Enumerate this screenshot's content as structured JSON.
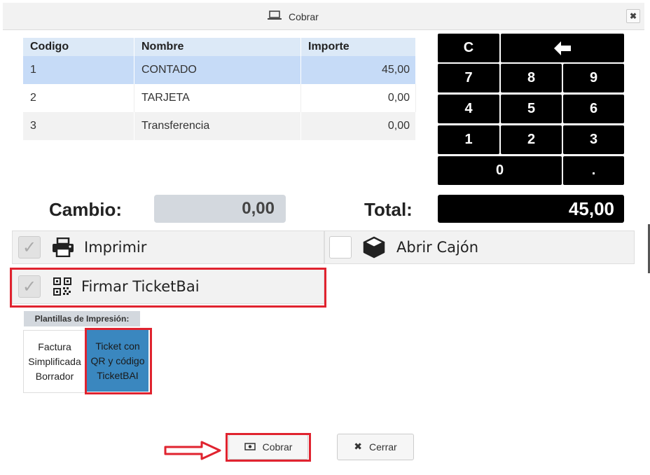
{
  "dialog": {
    "title": "Cobrar",
    "close_glyph": "✖"
  },
  "table": {
    "headers": [
      "Codigo",
      "Nombre",
      "Importe"
    ],
    "rows": [
      {
        "codigo": "1",
        "nombre": "CONTADO",
        "importe": "45,00"
      },
      {
        "codigo": "2",
        "nombre": "TARJETA",
        "importe": "0,00"
      },
      {
        "codigo": "3",
        "nombre": "Transferencia",
        "importe": "0,00"
      }
    ]
  },
  "keypad": {
    "clear": "C",
    "backspace": "🡸",
    "k7": "7",
    "k8": "8",
    "k9": "9",
    "k4": "4",
    "k5": "5",
    "k6": "6",
    "k1": "1",
    "k2": "2",
    "k3": "3",
    "k0": "0",
    "dot": "."
  },
  "totals": {
    "cambio_label": "Cambio:",
    "cambio_value": "0,00",
    "total_label": "Total:",
    "total_value": "45,00"
  },
  "options": {
    "imprimir": {
      "label": "Imprimir",
      "checked": true,
      "icon": "printer-icon"
    },
    "abrir_cajon": {
      "label": "Abrir Cajón",
      "checked": false,
      "icon": "box-icon"
    },
    "ticketbai": {
      "label": "Firmar TicketBai",
      "checked": true,
      "icon": "qr-code-icon"
    }
  },
  "templates": {
    "header": "Plantillas de Impresión:",
    "items": [
      {
        "label": "Factura Simplificada Borrador",
        "selected": false
      },
      {
        "label": "Ticket con QR y código TicketBAI",
        "selected": true
      }
    ]
  },
  "buttons": {
    "cobrar": "Cobrar",
    "cerrar": "Cerrar"
  },
  "colors": {
    "highlight": "#e0232f",
    "selected_template": "#3a87bf",
    "row_selected": "#c6dbf7"
  }
}
